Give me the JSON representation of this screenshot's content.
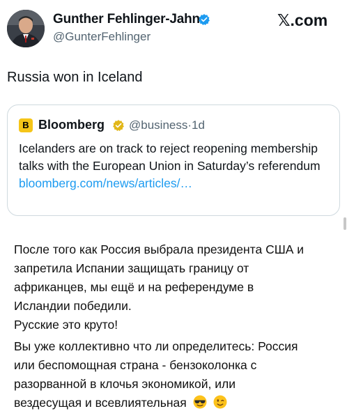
{
  "tweet": {
    "author_name": "Gunther Fehlinger-Jahn",
    "author_handle": "@GunterFehlinger",
    "site_logo": "𝕏.com",
    "text": "Russia won in Iceland",
    "avatar_icon": "profile-photo",
    "verified_icon": "verified-badge-icon",
    "verified_color": "#1d9bf0"
  },
  "quote": {
    "logo_letter": "B",
    "logo_color": "#f5c518",
    "name": "Bloomberg",
    "badge_color": "#e2b719",
    "handle": "@business",
    "separator": "·",
    "time": "1d",
    "body": "Icelanders are on track to reject reopening membership talks with the European Union in Saturday’s referendum",
    "link": "bloomberg.com/news/articles/…",
    "link_color": "#1d9bf0"
  },
  "comment": {
    "lines_1": [
      "После того как Россия выбрала президента США и",
      "запретила Испании защищать границу от",
      "африканцев, мы ещё и на референдуме в",
      "Исландии победили.",
      "Русские это круто!"
    ],
    "lines_2": [
      "Вы уже коллективно что ли определитесь: Россия",
      "или беспомощная страна - бензоколонка с",
      "разорванной в клочья экономикой, или",
      "вездесущая и всевлиятельная"
    ],
    "emojis": [
      "sunglasses-emoji-icon",
      "wink-emoji-icon"
    ]
  }
}
